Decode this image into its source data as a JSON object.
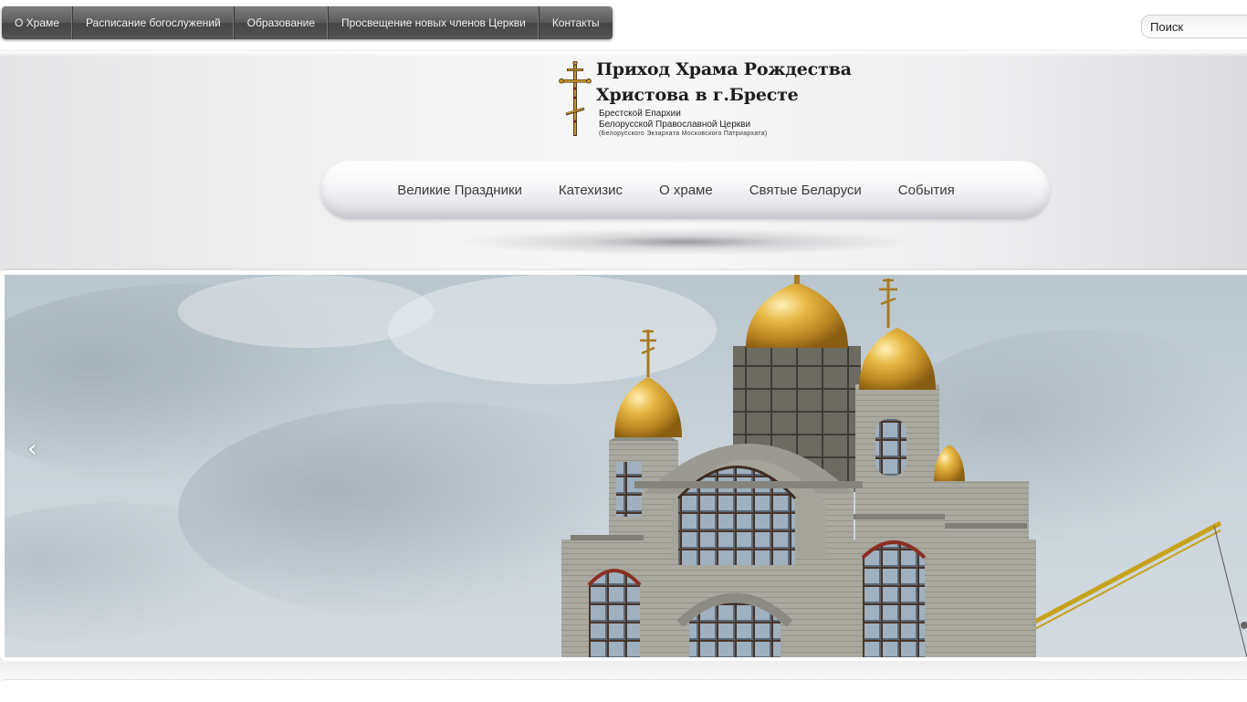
{
  "top_nav": {
    "items": [
      {
        "label": "О Храме"
      },
      {
        "label": "Расписание богослужений"
      },
      {
        "label": "Образование"
      },
      {
        "label": "Просвещение новых членов Церкви"
      },
      {
        "label": "Контакты"
      }
    ]
  },
  "search": {
    "placeholder": "Поиск",
    "value": ""
  },
  "logo": {
    "title_line1": "Приход Храма Рождества",
    "title_line2": "Христова в г.Бресте",
    "subtitle_line1": "Брестской Епархии",
    "subtitle_line2": "Белорусской Православной Церкви",
    "subtitle_line3": "(Белорусского Экзархата Московского Патриархата)"
  },
  "main_menu": {
    "items": [
      {
        "label": "Великие Праздники"
      },
      {
        "label": "Катехизис"
      },
      {
        "label": "О храме"
      },
      {
        "label": "Святые Беларуси"
      },
      {
        "label": "События"
      }
    ]
  },
  "slider": {
    "prev_arrow": "‹"
  },
  "colors": {
    "top_nav_bg": "#5b5b5b",
    "dome_gold": "#d9a62b",
    "sky": "#c3cfd6",
    "brick": "#a9a89f"
  },
  "icons": {
    "prev": "chevron-left-icon",
    "cross": "orthodox-cross-icon"
  }
}
